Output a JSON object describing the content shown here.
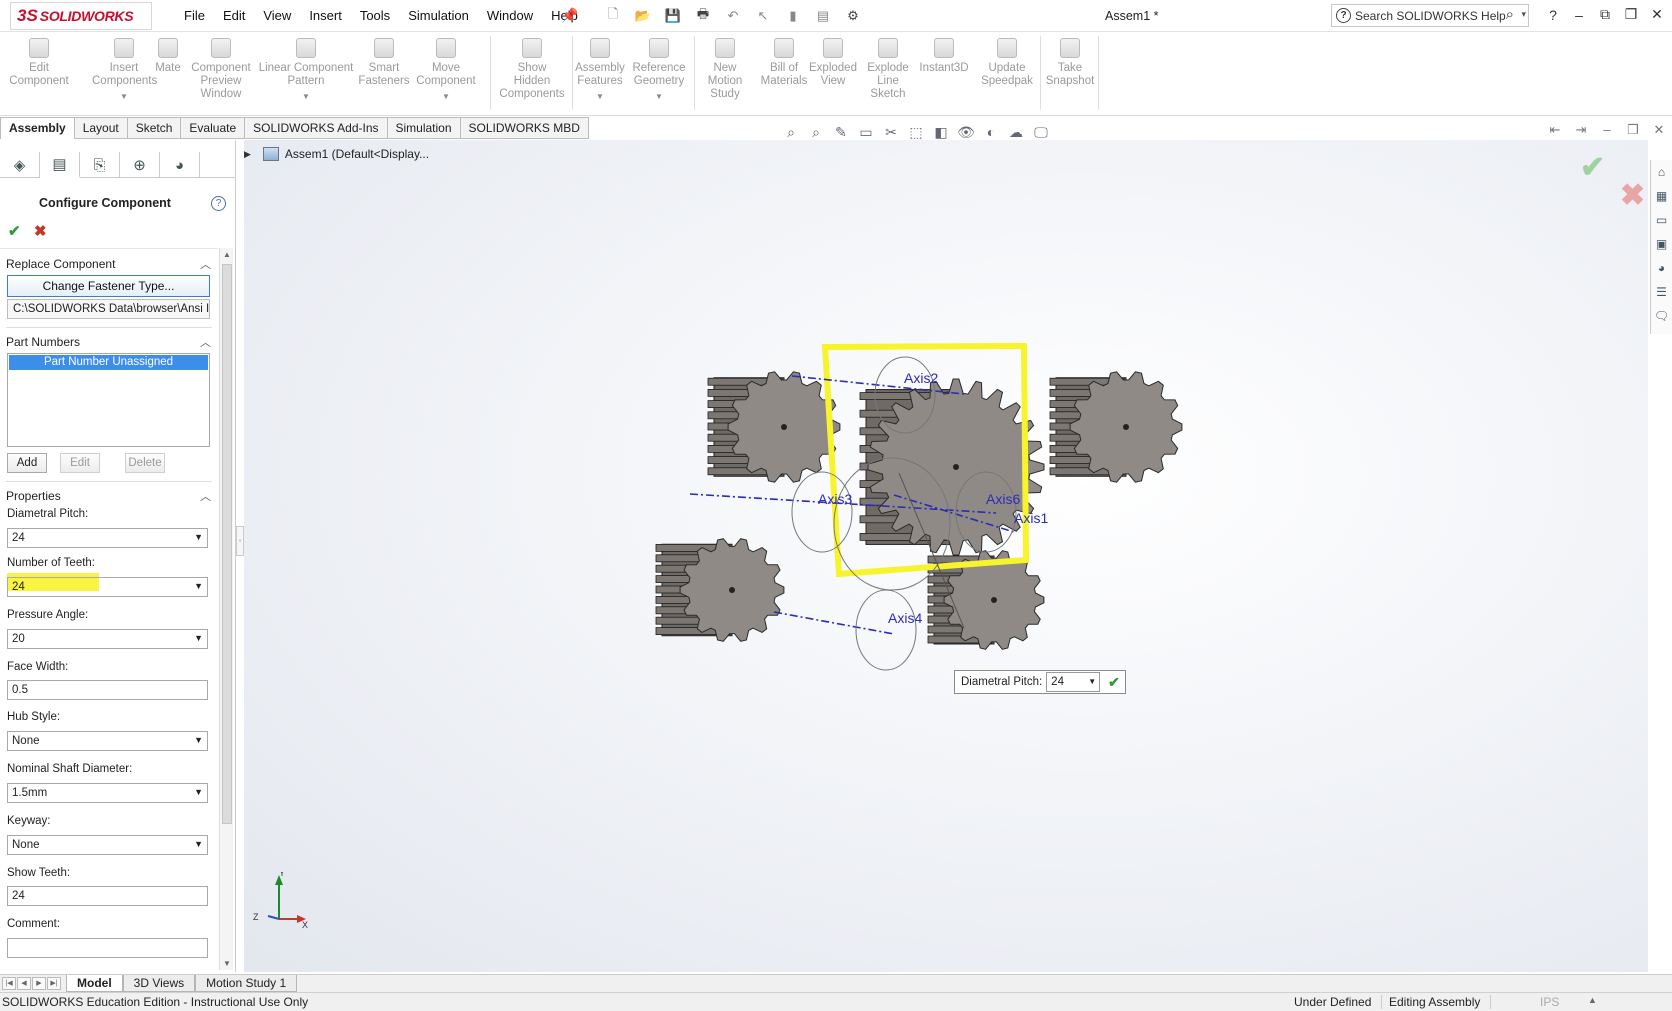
{
  "app": {
    "brand_prefix": "3S",
    "brand_name": "SOLIDWORKS",
    "document_title": "Assem1 *"
  },
  "menu": [
    "File",
    "Edit",
    "View",
    "Insert",
    "Tools",
    "Simulation",
    "Window",
    "Help"
  ],
  "search": {
    "placeholder": "Search SOLIDWORKS Help"
  },
  "ribbon": [
    {
      "label": "Edit\nComponent"
    },
    {
      "label": "Insert\nComponents"
    },
    {
      "label": "Mate"
    },
    {
      "label": "Component\nPreview\nWindow"
    },
    {
      "label": "Linear Component\nPattern"
    },
    {
      "label": "Smart\nFasteners"
    },
    {
      "label": "Move\nComponent"
    },
    {
      "label": "Show\nHidden\nComponents"
    },
    {
      "label": "Assembly\nFeatures"
    },
    {
      "label": "Reference\nGeometry"
    },
    {
      "label": "New\nMotion\nStudy"
    },
    {
      "label": "Bill of\nMaterials"
    },
    {
      "label": "Exploded\nView"
    },
    {
      "label": "Explode\nLine\nSketch"
    },
    {
      "label": "Instant3D"
    },
    {
      "label": "Update\nSpeedpak"
    },
    {
      "label": "Take\nSnapshot"
    }
  ],
  "cm_tabs": [
    "Assembly",
    "Layout",
    "Sketch",
    "Evaluate",
    "SOLIDWORKS Add-Ins",
    "Simulation",
    "SOLIDWORKS MBD"
  ],
  "tree": {
    "root": "Assem1  (Default<Display..."
  },
  "property_manager": {
    "title": "Configure Component",
    "replace_group": "Replace Component",
    "change_fastener": "Change Fastener Type...",
    "path": "C:\\SOLIDWORKS Data\\browser\\Ansi In",
    "part_numbers_group": "Part Numbers",
    "part_number_selected": "Part Number Unassigned",
    "add": "Add",
    "edit": "Edit",
    "delete": "Delete",
    "properties_group": "Properties",
    "diametral_pitch_label": "Diametral Pitch:",
    "diametral_pitch": "24",
    "teeth_label": "Number of Teeth:",
    "teeth": "24",
    "pressure_angle_label": "Pressure Angle:",
    "pressure_angle": "20",
    "face_width_label": "Face Width:",
    "face_width": "0.5",
    "hub_style_label": "Hub Style:",
    "hub_style": "None",
    "shaft_label": "Nominal Shaft Diameter:",
    "shaft": "1.5mm",
    "keyway_label": "Keyway:",
    "keyway": "None",
    "show_teeth_label": "Show Teeth:",
    "show_teeth": "24",
    "comment_label": "Comment:"
  },
  "axes": [
    "Axis2",
    "Axis3",
    "Axis6",
    "Axis1",
    "Axis4"
  ],
  "triad": {
    "x": "X",
    "y": "Y",
    "z": "Z"
  },
  "popup": {
    "label": "Diametral Pitch:",
    "value": "24"
  },
  "bottom_tabs": [
    "Model",
    "3D Views",
    "Motion Study 1"
  ],
  "status": {
    "left": "SOLIDWORKS Education Edition - Instructional Use Only",
    "state": "Under Defined",
    "mode": "Editing Assembly",
    "units": "IPS"
  },
  "colors": {
    "brand": "#c8102e",
    "selection_highlight": "#f7f32c",
    "axis_line": "#2b2bb8",
    "gear": "#8f8a85"
  }
}
